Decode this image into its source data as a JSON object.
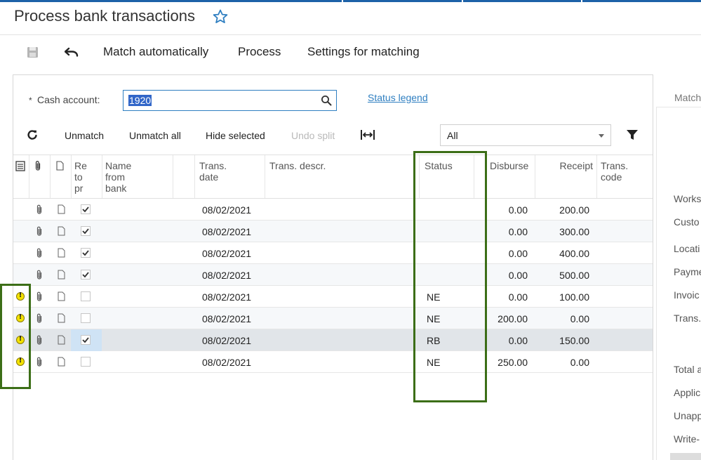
{
  "page": {
    "title": "Process bank transactions"
  },
  "toolbar": {
    "match_auto": "Match automatically",
    "process": "Process",
    "settings": "Settings for matching"
  },
  "form": {
    "cash_label": "Cash account:",
    "required_mark": "*",
    "cash_value": "1920",
    "status_legend": "Status legend"
  },
  "grid_toolbar": {
    "unmatch": "Unmatch",
    "unmatch_all": "Unmatch all",
    "hide_selected": "Hide selected",
    "undo_split": "Undo split",
    "filter_value": "All"
  },
  "columns": {
    "ready": "Re\nto\npr",
    "name": "Name\nfrom\nbank",
    "date": "Trans.\ndate",
    "descr": "Trans. descr.",
    "status": "Status",
    "disburse": "Disburse",
    "receipt": "Receipt",
    "code": "Trans.\ncode"
  },
  "rows": [
    {
      "warn": false,
      "checked": true,
      "date": "08/02/2021",
      "status": "",
      "disburse": "0.00",
      "receipt": "200.00"
    },
    {
      "warn": false,
      "checked": true,
      "date": "08/02/2021",
      "status": "",
      "disburse": "0.00",
      "receipt": "300.00"
    },
    {
      "warn": false,
      "checked": true,
      "date": "08/02/2021",
      "status": "",
      "disburse": "0.00",
      "receipt": "400.00"
    },
    {
      "warn": false,
      "checked": true,
      "date": "08/02/2021",
      "status": "",
      "disburse": "0.00",
      "receipt": "500.00"
    },
    {
      "warn": true,
      "checked": false,
      "date": "08/02/2021",
      "status": "NE",
      "disburse": "0.00",
      "receipt": "100.00"
    },
    {
      "warn": true,
      "checked": false,
      "date": "08/02/2021",
      "status": "NE",
      "disburse": "200.00",
      "receipt": "0.00"
    },
    {
      "warn": true,
      "checked": true,
      "date": "08/02/2021",
      "status": "RB",
      "disburse": "0.00",
      "receipt": "150.00"
    },
    {
      "warn": true,
      "checked": false,
      "date": "08/02/2021",
      "status": "NE",
      "disburse": "250.00",
      "receipt": "0.00"
    }
  ],
  "right_panel": {
    "tab": "Match",
    "labels": [
      "Works",
      "Custo",
      "Locati",
      "Payme",
      "Invoic",
      "Trans.",
      "Total a",
      "Applic",
      "Unapp",
      "Write-"
    ]
  },
  "colors": {
    "accent": "#2f7fc1",
    "highlight_box": "#3c6e17",
    "warning": "#f3e200"
  }
}
